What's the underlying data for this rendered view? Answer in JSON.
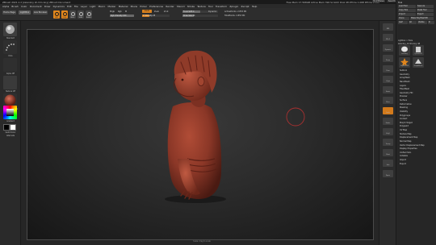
{
  "colors": {
    "accent": "#e0861d",
    "model": "#8b3727",
    "brush_cursor": "#a83030",
    "canvas_bg": "#2c2c2c"
  },
  "window": {
    "title": "ZBrush 2021.1.2  [zelenkoy zh-hlm-boy]    ZBrush Document",
    "title_right": "Free Mem 17.568GB  Active Mem 394  Scratch Disk 48  ZTime 1.068  RTime 4.102",
    "top_buttons": [
      "QuickSave",
      "See-through 0",
      "Menus",
      "DefaultZScript"
    ]
  },
  "menubar": {
    "items": [
      "Alpha",
      "Brush",
      "Color",
      "Document",
      "Draw",
      "Dynamics",
      "Edit",
      "File",
      "Layer",
      "Light",
      "Macro",
      "Marker",
      "Material",
      "Movie",
      "Picker",
      "Preferences",
      "Render",
      "Stencil",
      "Stroke",
      "Texture",
      "Tool",
      "Transform",
      "Zplugin",
      "Zscript",
      "Help"
    ]
  },
  "shelf": {
    "home_page": "Home Page",
    "lightbox": "LightBox",
    "live_boolean": "Live Boolean",
    "tools": [
      {
        "label": "Edit",
        "icon": "edit-icon",
        "active": true
      },
      {
        "label": "Draw",
        "icon": "draw-icon",
        "active": true
      },
      {
        "label": "Move",
        "icon": "move-icon",
        "active": false
      },
      {
        "label": "Scale",
        "icon": "scale-icon",
        "active": false
      },
      {
        "label": "Rotate",
        "icon": "rotate-icon",
        "active": false
      }
    ],
    "mrgb": "Mrgb",
    "rgb": "Rgb",
    "m": "M",
    "zadd": "Zadd",
    "zsub": "Zsub",
    "zcut": "Zcut",
    "rgb_intensity": "Rgb Intensity 100",
    "z_intensity": "Z Intensity 25",
    "focal_shift": "Focal Shift 0",
    "draw_size": "Draw Size 64",
    "dynamic": "Dynamic",
    "active_points": "ActivePoints: 2.853 Mil",
    "total_points": "TotalPoints: 2.853 Mil"
  },
  "left_shelf": {
    "brush_label": "Standard",
    "stroke_label": "Dots",
    "alpha_label": "Alpha Off",
    "texture_label": "Texture Off",
    "material_label": "MatCap Red Wax",
    "gradient_label": "Gradient",
    "switch_color": "SwitchColor",
    "alternate": "Alternate"
  },
  "right_shelf": {
    "items": [
      "BPR",
      "SPix 3",
      "Dynamic",
      "Persp",
      "Floor",
      "L.Sym",
      "Frame",
      "Move",
      "Scale",
      "Rotate",
      "PolyF",
      "Transp",
      "Ghost",
      "Solo",
      "Xpose"
    ],
    "active": [
      "Scale"
    ]
  },
  "palette": {
    "header": "Tool",
    "rows": [
      "Load Tool",
      "Save As",
      "Copy Tool",
      "Paste Tool",
      "Import",
      "Export",
      "Clone",
      "Make PolyMesh3D",
      "GoZ",
      "All",
      "Visible",
      "R"
    ],
    "lightbox_tools": "Lightbox > Tools",
    "current_tool": "zelenkoy_zh-hlm-boy: 48",
    "thumbs": [
      "zelenkoy",
      "Cylinder3D",
      "PolyMesh3D",
      "SimpleBrush"
    ],
    "subpanels": [
      "Subtool",
      "Geometry",
      "ArrayMesh",
      "NanoMesh",
      "Layers",
      "FiberMesh",
      "Geometry HD",
      "Preview",
      "Surface",
      "Deformation",
      "Masking",
      "Visibility",
      "Polygroups",
      "Contact",
      "Morph Target",
      "Polypaint",
      "UV Map",
      "Texture Map",
      "Displacement Map",
      "Normal Map",
      "Vector Displacement Map",
      "Display Properties",
      "Unified Skin",
      "Initialize",
      "Import",
      "Export"
    ]
  },
  "canvas": {
    "status": "Scale: drag to scale"
  }
}
